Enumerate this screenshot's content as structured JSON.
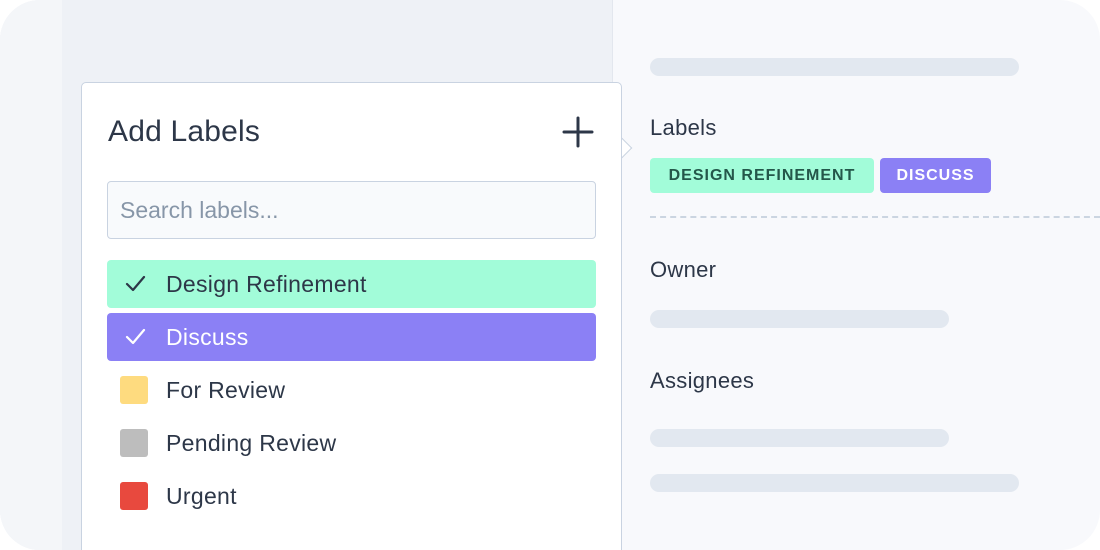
{
  "popover": {
    "title": "Add Labels",
    "add_icon": "plus-icon",
    "search_placeholder": "Search labels...",
    "labels": [
      {
        "name": "Design Refinement",
        "color": "#a2fcd9",
        "selected": true,
        "text_color": "#2d3748",
        "check_color": "#2d3748"
      },
      {
        "name": "Discuss",
        "color": "#8b80f5",
        "selected": true,
        "text_color": "#ffffff",
        "check_color": "#ffffff"
      },
      {
        "name": "For Review",
        "color": "#fedb7f",
        "selected": false
      },
      {
        "name": "Pending Review",
        "color": "#bdbdbd",
        "selected": false
      },
      {
        "name": "Urgent",
        "color": "#e8493e",
        "selected": false
      }
    ]
  },
  "details": {
    "labels_heading": "Labels",
    "applied_tags": [
      {
        "text": "DESIGN REFINEMENT",
        "bg": "#a2fcd9",
        "fg": "#24574a"
      },
      {
        "text": "DISCUSS",
        "bg": "#8b80f5",
        "fg": "#ffffff"
      }
    ],
    "owner_heading": "Owner",
    "assignees_heading": "Assignees"
  }
}
